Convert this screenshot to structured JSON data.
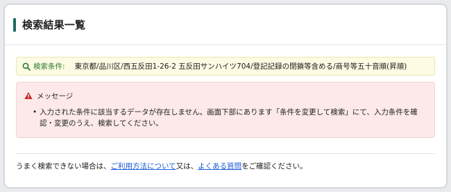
{
  "header": {
    "title": "検索結果一覧"
  },
  "criteria": {
    "icon": "search-icon",
    "label": "検索条件:",
    "value": "東京都/品川区/西五反田1-26-2 五反田サンハイツ704/登記記録の閉鎖等含める/商号等五十音順(昇順)"
  },
  "message": {
    "icon": "warning-icon",
    "title": "メッセージ",
    "items": [
      "入力された条件に該当するデータが存在しません。画面下部にあります「条件を変更して検索」にて、入力条件を確認・変更のうえ、検索してください。"
    ]
  },
  "help": {
    "prefix": "うまく検索できない場合は、",
    "link1": "ご利用方法について",
    "middle": "又は、",
    "link2": "よくある質問",
    "suffix": "をご確認ください。"
  },
  "colors": {
    "accent": "#1f6b64",
    "criteria_bg": "#fdfbe3",
    "criteria_label": "#2e7d32",
    "message_bg": "#fde9e9",
    "warning": "#c62828",
    "link": "#1a5bd6"
  }
}
